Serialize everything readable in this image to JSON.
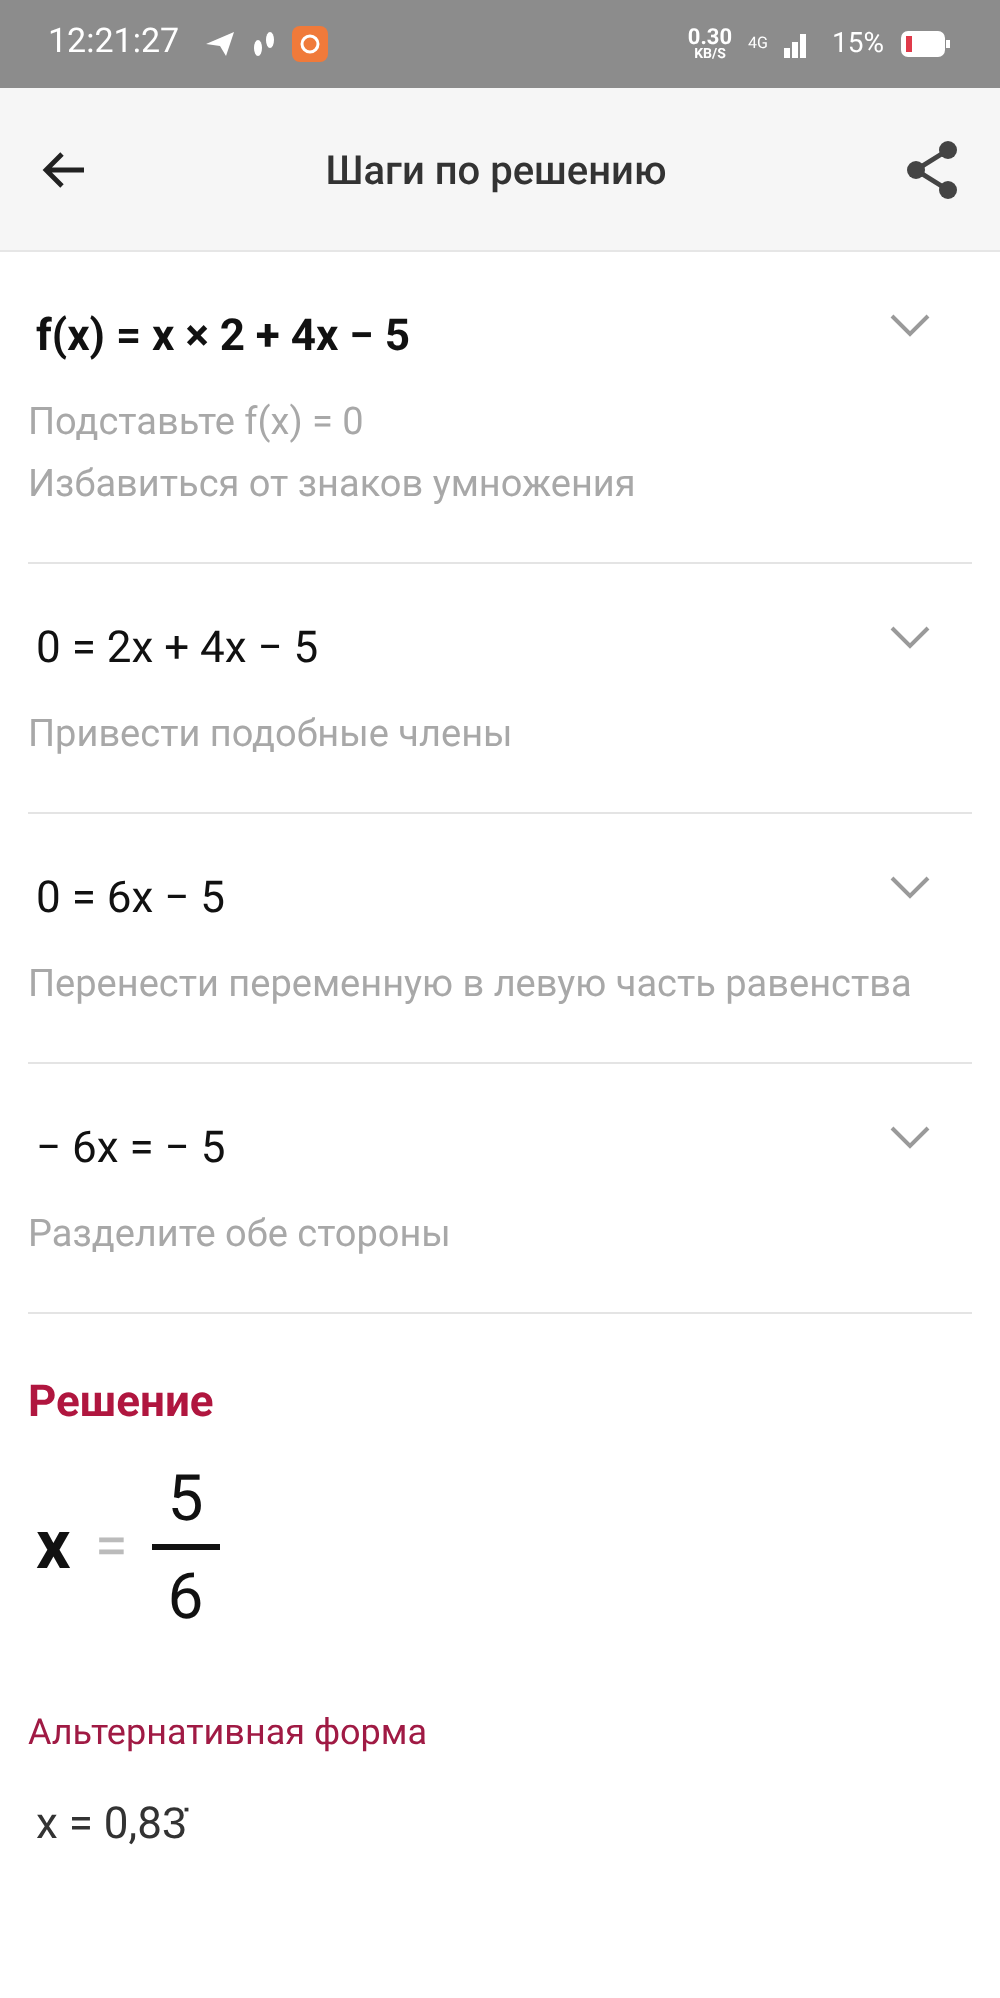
{
  "status_bar": {
    "time": "12:21:27",
    "speed_value": "0.30",
    "speed_unit": "KB/S",
    "network": "4G",
    "battery": "15%"
  },
  "header": {
    "title": "Шаги по решению"
  },
  "steps": [
    {
      "formula": "f(x) = x × 2 + 4x − 5",
      "bold": true,
      "expanded": false,
      "notes": [
        "Подставьте f(x) = 0",
        "Избавиться от знаков умножения"
      ]
    },
    {
      "formula": "0 = 2x + 4x − 5",
      "bold": false,
      "expanded": false,
      "notes": [
        "Привести подобные члены"
      ]
    },
    {
      "formula": "0 = 6x − 5",
      "bold": false,
      "expanded": false,
      "notes": [
        "Перенести переменную в левую часть равенства"
      ]
    },
    {
      "formula": "− 6x = − 5",
      "bold": false,
      "expanded": false,
      "notes": [
        "Разделите обе стороны"
      ]
    }
  ],
  "solution": {
    "heading": "Решение",
    "variable": "x",
    "equals": "=",
    "numerator": "5",
    "denominator": "6",
    "alt_heading": "Альтернативная форма",
    "alt_value": "x = 0,83̇"
  }
}
